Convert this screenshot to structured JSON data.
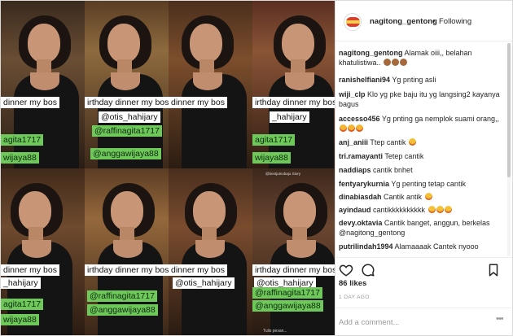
{
  "photo": {
    "stickers": {
      "birthday_a": "dinner my bos",
      "birthday_b": "irthday dinner my bos",
      "birthday_c": "dinner my bos",
      "birthday_d": "irthday dinner my bos",
      "birthday_e": "dinner my bos",
      "birthday_f": "irthday dinner my bos",
      "birthday_g": "dinner my bos",
      "birthday_h": "irthday dinner my bos",
      "otis_1": "@otis_hahijary",
      "otis_2": "_hahijary",
      "otis_3": "@otis_hahijary",
      "otis_4": "@otis_hahijary",
      "otis_5": "_hahijary",
      "otis_6": "@otis_hahijary",
      "raffi_1": "agita1717",
      "raffi_2": "@raffinagita1717",
      "raffi_3": "agita1717",
      "raffi_4": "@raffinagita1717",
      "raffi_5": "@raffinagita1717",
      "anggaw_1": "@anggawijaya88",
      "anggaw_2": "wijaya88",
      "anggaw_3": "@anggawijaya88",
      "anggaw_4": "wijaya88",
      "anggaw_5": "@anggawijaya88",
      "anggaw_6": "@anggawijaya88",
      "watermark": "@bestjutnobaju Story",
      "caption_hint": "Tulis pesan..."
    }
  },
  "header": {
    "username": "nagitong_gentong",
    "separator": "•",
    "follow_status": "Following"
  },
  "comments": [
    {
      "user": "nagitong_gentong",
      "text": "Alamak oiii,, belahan khatulistiwa..",
      "emoji": [
        "monkey-icon",
        "monkey-icon",
        "monkey-icon"
      ]
    },
    {
      "user": "ranishelfiani94",
      "text": "Yg pnting asli",
      "emoji": []
    },
    {
      "user": "wiji_clp",
      "text": "Klo yg pke baju itu yg langsing2 kayanya bagus",
      "emoji": []
    },
    {
      "user": "accesso456",
      "text": "Yg pnting ga nemplok suami orang,,",
      "emoji": [
        "laughing-icon",
        "laughing-icon",
        "laughing-icon"
      ]
    },
    {
      "user": "anj_aniii",
      "text": "Ttep cantik",
      "emoji": [
        "heart-eyes-icon"
      ]
    },
    {
      "user": "tri.ramayanti",
      "text": "Tetep cantik",
      "emoji": []
    },
    {
      "user": "naddiaps",
      "text": "cantik bnhet",
      "emoji": []
    },
    {
      "user": "fentyarykurnia",
      "text": "Yg penting tetap cantik",
      "emoji": []
    },
    {
      "user": "dinabiasdah",
      "text": "Cantik antik",
      "emoji": [
        "heart-eyes-icon"
      ]
    },
    {
      "user": "ayindaud",
      "text": "cantikkkkkkkkkk",
      "emoji": [
        "heart-eyes-icon",
        "heart-eyes-icon",
        "heart-eyes-icon"
      ]
    },
    {
      "user": "devy.oktavia",
      "text": "Cantik banget, anggun, berkelas @nagitong_gentong",
      "emoji": []
    },
    {
      "user": "putrilindah1994",
      "text": "Alamaaaak Cantek nyooo",
      "emoji": []
    }
  ],
  "footer": {
    "likes": "86 likes",
    "time": "1 DAY AGO",
    "add_comment_placeholder": "Add a comment...",
    "more": "•••"
  },
  "colors": {
    "sticker_green": "#6ec95a",
    "border": "#dbdbdb",
    "muted": "#999999"
  }
}
